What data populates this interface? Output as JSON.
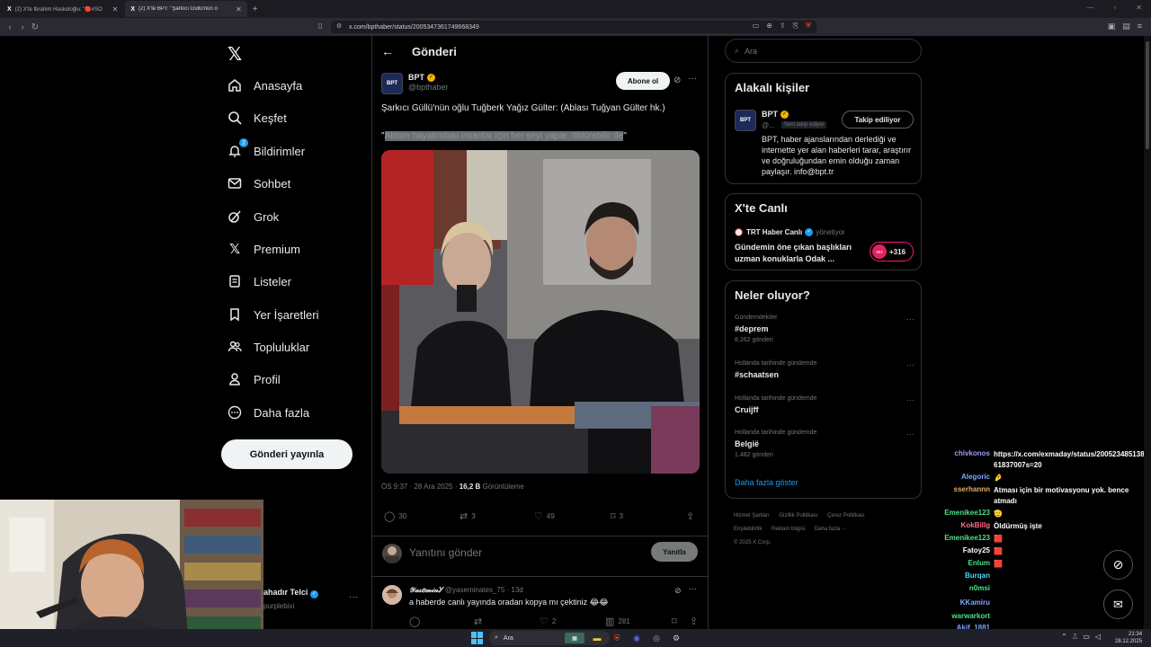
{
  "browser": {
    "tabs": [
      {
        "title": "(2) X'te İbrahim Haskoloğlu: \"🔴#SO",
        "active": false
      },
      {
        "title": "(2) X'te BPT: \"Şarkıcı Güllü'nün o",
        "active": true
      }
    ],
    "url": "x.com/bpthaber/status/2005347361749668349"
  },
  "nav": {
    "items": [
      {
        "label": "Anasayfa",
        "icon": "home-icon"
      },
      {
        "label": "Keşfet",
        "icon": "search-icon"
      },
      {
        "label": "Bildirimler",
        "icon": "bell-icon",
        "badge": "2"
      },
      {
        "label": "Sohbet",
        "icon": "envelope-icon"
      },
      {
        "label": "Grok",
        "icon": "grok-icon"
      },
      {
        "label": "Premium",
        "icon": "x-logo-icon"
      },
      {
        "label": "Listeler",
        "icon": "list-icon"
      },
      {
        "label": "Yer İşaretleri",
        "icon": "bookmark-icon"
      },
      {
        "label": "Topluluklar",
        "icon": "people-icon"
      },
      {
        "label": "Profil",
        "icon": "person-icon"
      },
      {
        "label": "Daha fazla",
        "icon": "more-circle-icon"
      }
    ],
    "post_button": "Gönderi yayınla"
  },
  "main": {
    "title": "Gönderi",
    "post": {
      "avatar_text": "BPT",
      "author": "BPT",
      "handle": "@bpthaber",
      "subscribe": "Abone ol",
      "text": "Şarkıcı Güllü'nün oğlu Tuğberk Yağız Gülter: (Ablası Tuğyan Gülter hk.)",
      "quote_open": "\"",
      "quote_body": "Ablam hayatındaki insanlar için her şeyi yapar, öldürebilir de",
      "quote_close": "\"",
      "time": "ÖS 9:37 · 28 Ara 2025 · ",
      "views": "16,2 B",
      "views_label": " Görüntüleme",
      "replies": "30",
      "reposts": "3",
      "likes": "49",
      "bookmarks": "3"
    },
    "reply_placeholder": "Yanıtını gönder",
    "reply_button": "Yanıtla",
    "reply": {
      "name": "𝒴𝒶𝓈𝑒𝓂𝒾𝓃Ꭹ",
      "handle": "@yaseminates_75 · 13d",
      "text": "a haberde canlı yayında oradan kopya mı çektiniz 😂😂",
      "replies": "",
      "reposts": "",
      "likes": "2",
      "views": "281"
    }
  },
  "right": {
    "search_placeholder": "Ara",
    "related": {
      "title": "Alakalı kişiler",
      "name": "BPT",
      "handle": "@...",
      "follows_you": "Seni takip ediyor",
      "button": "Takip ediliyor",
      "bio": "BPT, haber ajanslarından derlediği ve internette yer alan haberleri tarar, araştırır ve doğruluğundan emin olduğu zaman paylaşır. info@bpt.tr"
    },
    "live": {
      "title": "X'te Canlı",
      "host": "TRT Haber Canlı",
      "host_sub": "yönetiyor",
      "headline": "Gündemin öne çıkan başlıkları uzman konuklarla Odak ...",
      "count": "+316"
    },
    "trends": {
      "title": "Neler oluyor?",
      "items": [
        {
          "context": "Gündemdekiler",
          "topic": "#deprem",
          "count": "8.262 gönderi"
        },
        {
          "context": "Hollanda tarihinde gündemde",
          "topic": "#schaatsen",
          "count": ""
        },
        {
          "context": "Hollanda tarihinde gündemde",
          "topic": "Cruijff",
          "count": ""
        },
        {
          "context": "Hollanda tarihinde gündemde",
          "topic": "België",
          "count": "1.482 gönderi"
        }
      ],
      "show_more": "Daha fazla göster"
    },
    "footer": [
      "Hizmet Şartları",
      "Gizlilik Politikası",
      "Çerez Politikası",
      "Erişilebilirlik",
      "Reklam bilgisi",
      "Daha fazla ···",
      "© 2025 X Corp."
    ]
  },
  "overlay_user": {
    "name": "ahadır Telci",
    "handle": "purplebixi"
  },
  "chat": [
    {
      "name": "chivkonos",
      "msg": "https://x.com/exmaday/status/20052348513861837007s=20",
      "color": "#9b9bff"
    },
    {
      "name": "Alegoric",
      "msg": "🤌",
      "color": "#7fa7ff"
    },
    {
      "name": "sserhannn",
      "msg": "Atması için bir motivasyonu yok. bence atmadı",
      "color": "#e0b060"
    },
    {
      "name": "Emenikee123",
      "msg": "🫡",
      "color": "#4ee08a"
    },
    {
      "name": "KokBillg",
      "msg": "Öldürmüş işte",
      "color": "#ff6b8a"
    },
    {
      "name": "Emenikee123",
      "msg": "🟥",
      "color": "#4ee08a"
    },
    {
      "name": "Fatoy25",
      "msg": "🟥",
      "color": "#ffffff"
    },
    {
      "name": "Enlum",
      "msg": "🟥",
      "color": "#4ee08a"
    },
    {
      "name": "Burqan",
      "msg": "",
      "color": "#4cd6ff"
    },
    {
      "name": "n0msi",
      "msg": "",
      "color": "#4ee08a"
    },
    {
      "name": "KKamiru",
      "msg": "",
      "color": "#7fa7ff"
    },
    {
      "name": "warwarkort",
      "msg": "",
      "color": "#4ee08a"
    },
    {
      "name": "Akif_1881",
      "msg": "",
      "color": "#7fa7ff"
    }
  ],
  "taskbar": {
    "search": "Ara",
    "time": "21:34",
    "date": "28.12.2025"
  }
}
